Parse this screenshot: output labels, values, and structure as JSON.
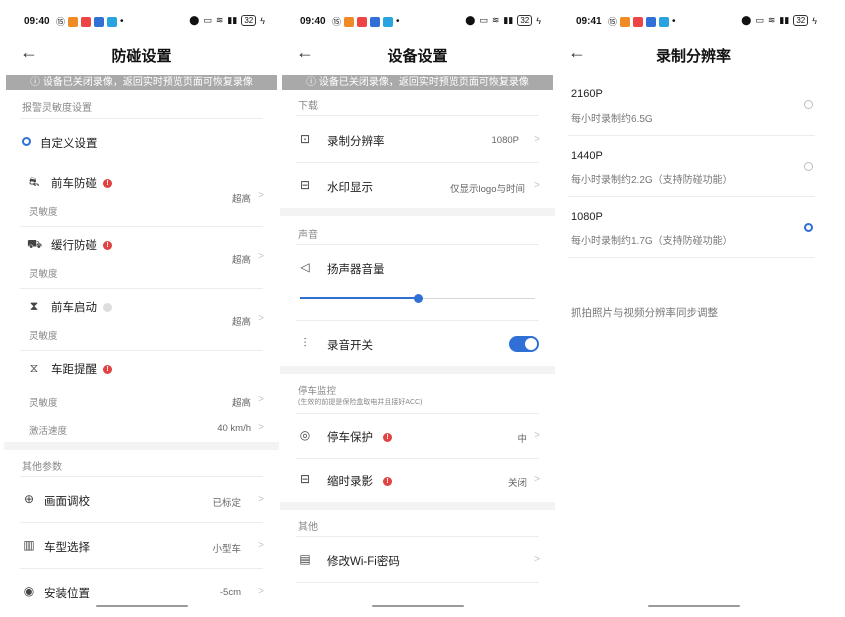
{
  "screens": [
    {
      "status": {
        "time": "09:40",
        "battery": "32"
      },
      "title": "防碰设置",
      "banner": "ⓘ 设备已关闭录像，返回实时预览页面可恢复录像",
      "section1": "报警灵敏度设置",
      "custom_label": "自定义设置",
      "items": [
        {
          "icon": "⛐",
          "label": "前车防碰",
          "badge": "red",
          "sub": "灵敏度",
          "value": "超高"
        },
        {
          "icon": "⛟",
          "label": "缓行防碰",
          "badge": "red",
          "sub": "灵敏度",
          "value": "超高"
        },
        {
          "icon": "⧗",
          "label": "前车启动",
          "badge": "gray",
          "sub": "灵敏度",
          "value": "超高"
        },
        {
          "icon": "⧖",
          "label": "车距提醒",
          "badge": "red"
        }
      ],
      "distance": {
        "sub1": "灵敏度",
        "value1": "超高",
        "sub2": "激活速度",
        "value2": "40 km/h"
      },
      "section2": "其他参数",
      "others": [
        {
          "icon": "⊕",
          "label": "画面调校",
          "value": "已标定"
        },
        {
          "icon": "▥",
          "label": "车型选择",
          "value": "小型车"
        },
        {
          "icon": "◉",
          "label": "安装位置",
          "value": "-5cm"
        }
      ]
    },
    {
      "status": {
        "time": "09:40",
        "battery": "32"
      },
      "title": "设备设置",
      "banner": "ⓘ 设备已关闭录像，返回实时预览页面可恢复录像",
      "download_head": "下载",
      "record_res": {
        "label": "录制分辨率",
        "value": "1080P"
      },
      "watermark": {
        "label": "水印显示",
        "value": "仅显示logo与时间"
      },
      "sound_head": "声音",
      "speaker": {
        "label": "扬声器音量",
        "level": 0.5
      },
      "record_switch": {
        "label": "录音开关",
        "on": true
      },
      "parking_head": "停车监控",
      "parking_note": "(生效的前提是保险盒取电并且接好ACC)",
      "parking_protect": {
        "label": "停车保护",
        "value": "中"
      },
      "timelapse": {
        "label": "缩时录影",
        "value": "关闭"
      },
      "other_head": "其他",
      "wifi": {
        "label": "修改Wi-Fi密码"
      }
    },
    {
      "status": {
        "time": "09:41",
        "battery": "32"
      },
      "title": "录制分辨率",
      "options": [
        {
          "label": "2160P",
          "desc": "每小时录制约6.5G",
          "selected": false
        },
        {
          "label": "1440P",
          "desc": "每小时录制约2.2G（支持防碰功能）",
          "selected": false
        },
        {
          "label": "1080P",
          "desc": "每小时录制约1.7G（支持防碰功能）",
          "selected": true
        }
      ],
      "note": "抓拍照片与视频分辨率同步调整"
    }
  ],
  "colors": {
    "accent": "#2f6fd6",
    "alert": "#e24141",
    "banner": "#a9a9a9"
  }
}
